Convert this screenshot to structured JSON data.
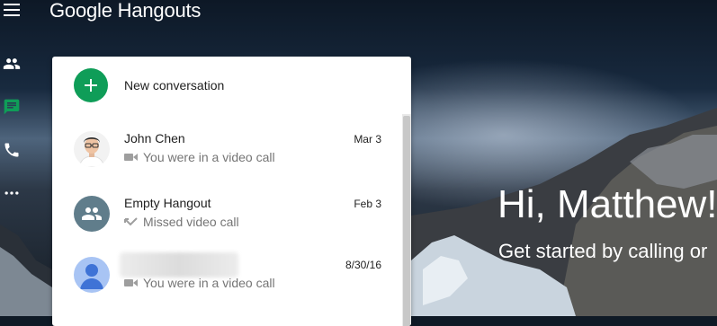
{
  "app": {
    "title": "Google Hangouts"
  },
  "nav": {
    "items": [
      {
        "name": "contacts",
        "icon": "people-icon"
      },
      {
        "name": "messages",
        "icon": "chat-icon",
        "active": true
      },
      {
        "name": "phone",
        "icon": "phone-icon"
      },
      {
        "name": "more",
        "icon": "more-icon"
      }
    ]
  },
  "colors": {
    "accent": "#0f9d58",
    "active_nav": "#0f9d58"
  },
  "new_conversation": {
    "label": "New conversation",
    "icon": "plus-icon"
  },
  "conversations": [
    {
      "name": "John Chen",
      "date": "Mar 3",
      "status": "You were in a video call",
      "status_icon": "video-icon"
    },
    {
      "name": "Empty Hangout",
      "date": "Feb 3",
      "status": "Missed video call",
      "status_icon": "missed-call-icon"
    },
    {
      "name": "",
      "date": "8/30/16",
      "status": "You were in a video call",
      "status_icon": "video-icon"
    }
  ],
  "welcome": {
    "greeting": "Hi, Matthew!",
    "subtitle": "Get started by calling or"
  }
}
